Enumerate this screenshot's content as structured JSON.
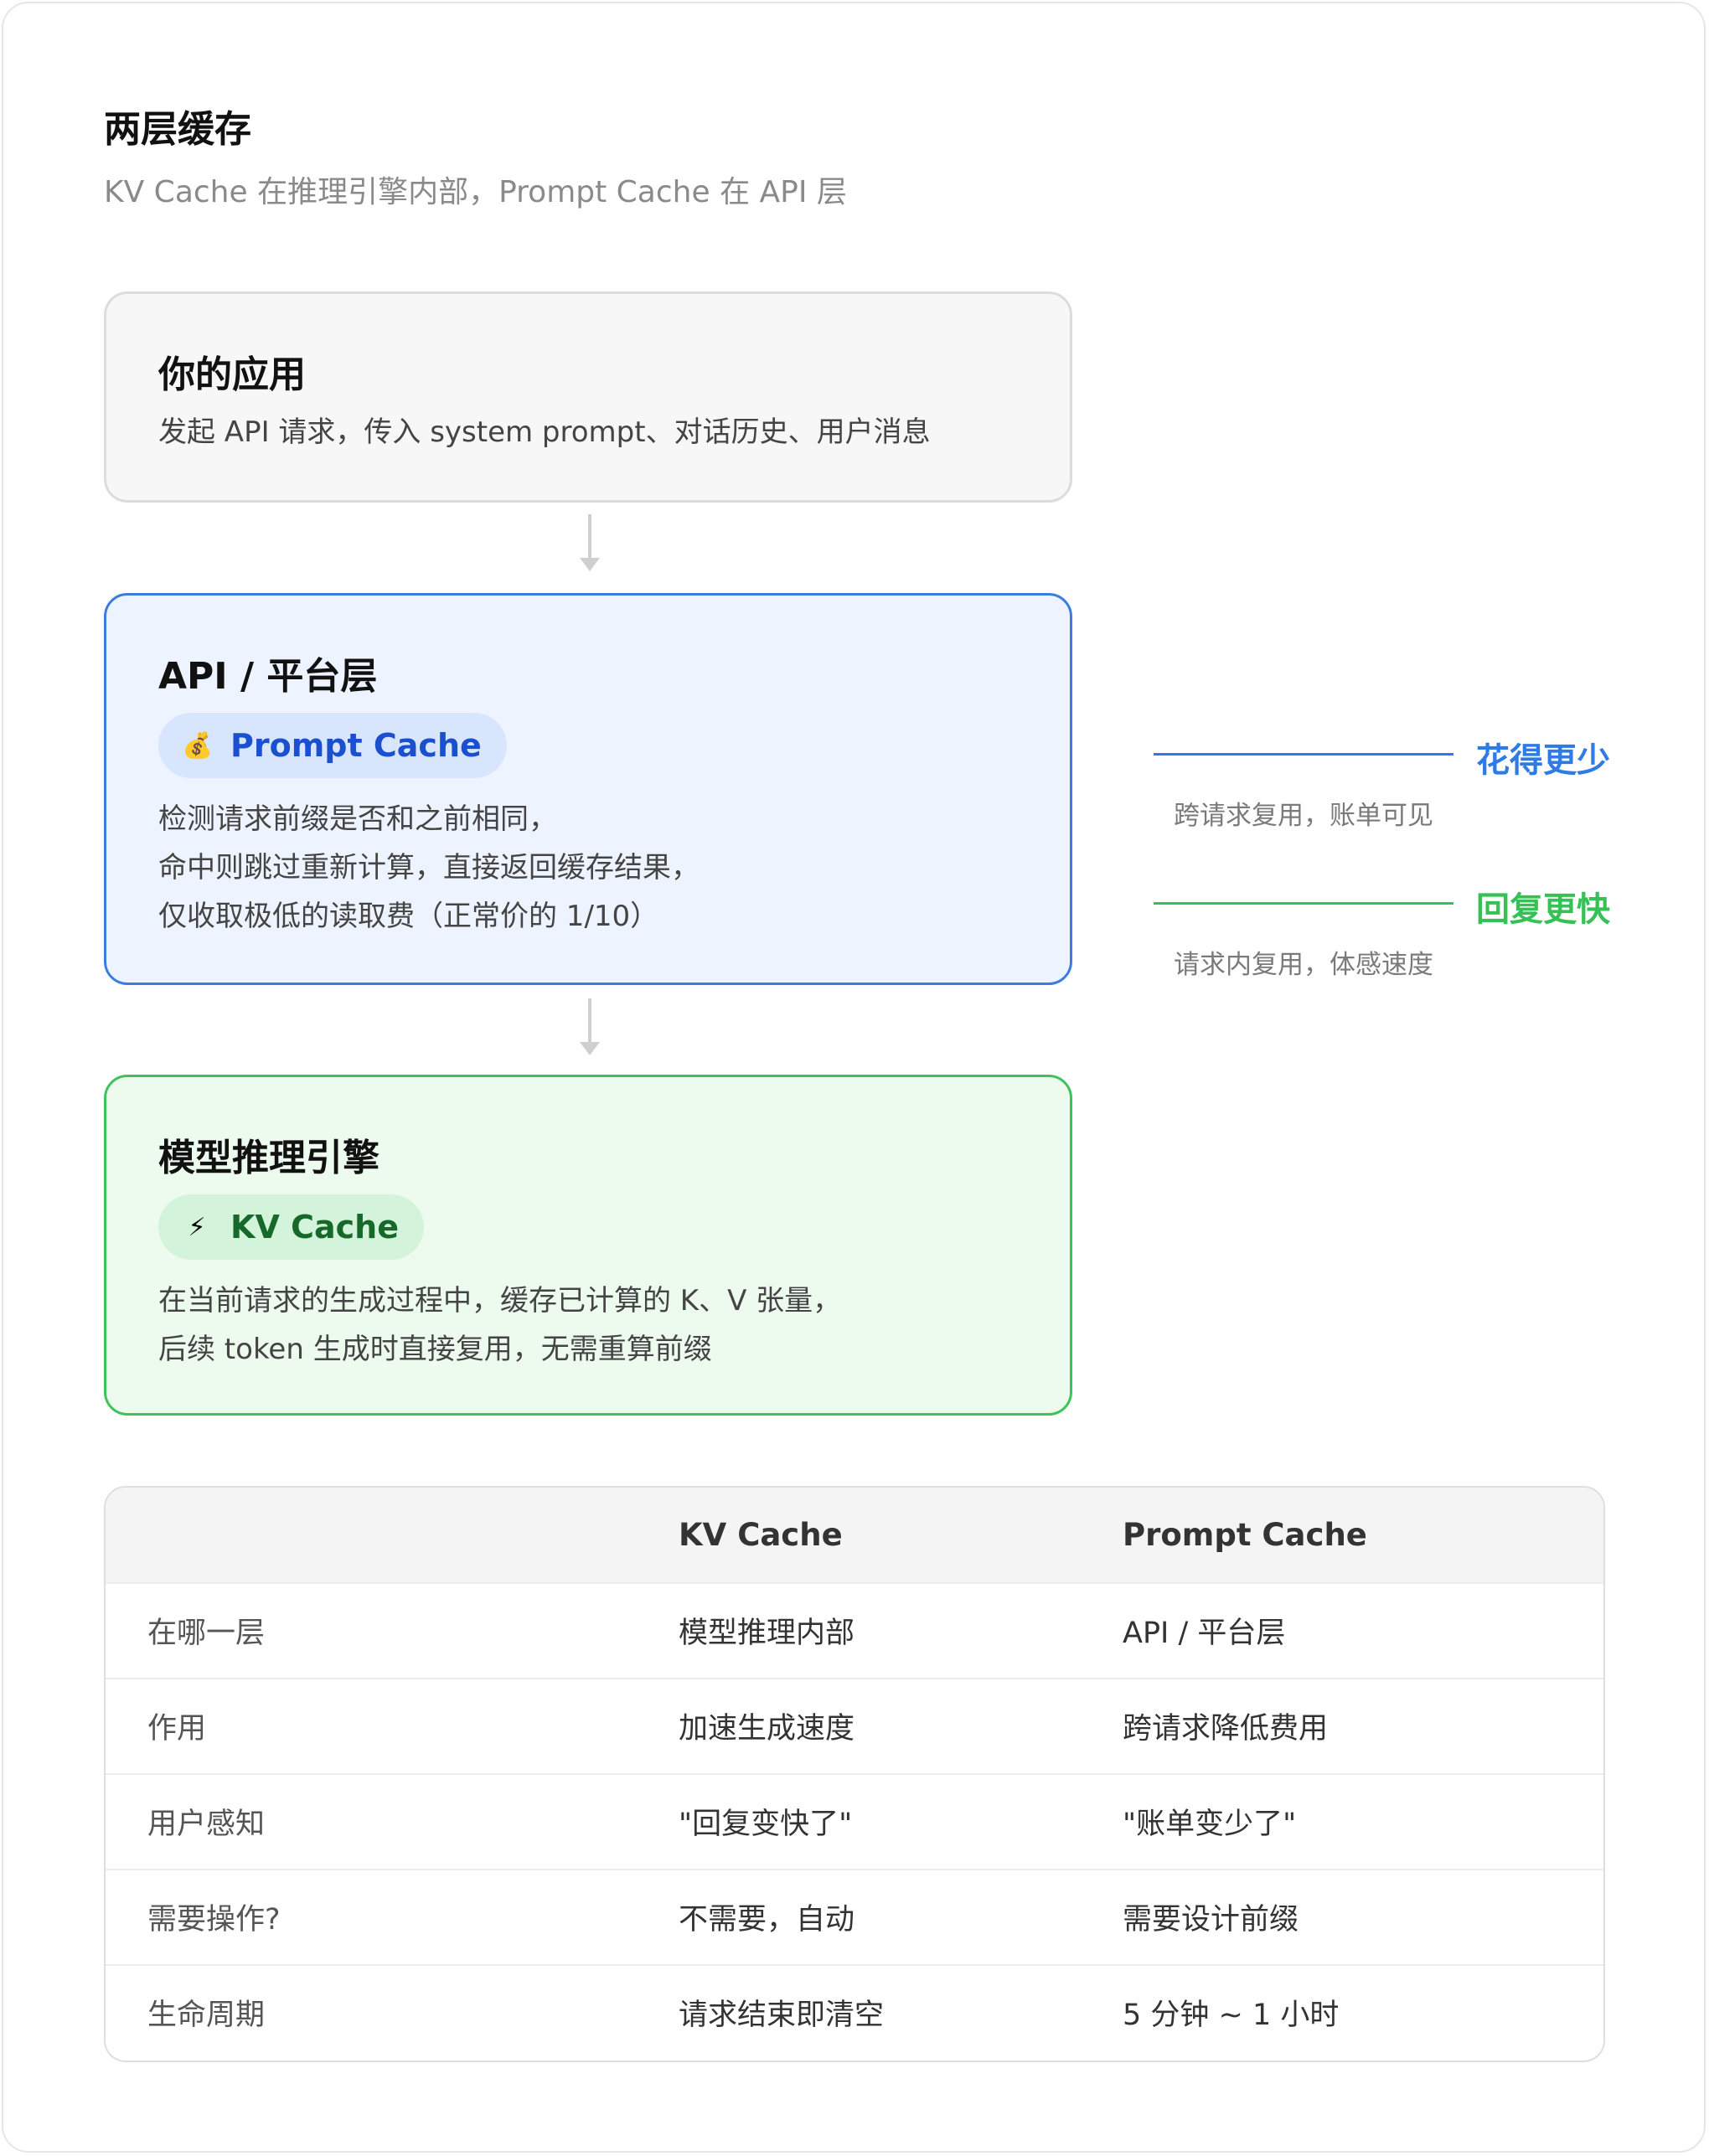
{
  "header": {
    "title": "两层缓存",
    "subtitle": "KV Cache 在推理引擎内部，Prompt Cache 在 API 层"
  },
  "app_box": {
    "title": "你的应用",
    "desc": "发起 API 请求，传入 system prompt、对话历史、用户消息"
  },
  "api_box": {
    "title": "API / 平台层",
    "pill_icon": "💰",
    "pill_label": "Prompt Cache",
    "desc_lines": [
      "检测请求前缀是否和之前相同，",
      "命中则跳过重新计算，直接返回缓存结果，",
      "仅收取极低的读取费（正常价的 1/10）"
    ]
  },
  "engine_box": {
    "title": "模型推理引擎",
    "pill_icon": "⚡",
    "pill_label": "KV Cache",
    "desc_lines": [
      "在当前请求的生成过程中，缓存已计算的 K、V 张量，",
      "后续 token 生成时直接复用，无需重算前缀"
    ]
  },
  "side": {
    "cost": {
      "label": "花得更少",
      "note": "跨请求复用，账单可见",
      "color": "#2f7be6"
    },
    "speed": {
      "label": "回复更快",
      "note": "请求内复用，体感速度",
      "color": "#35c155"
    }
  },
  "table": {
    "headers": [
      "",
      "KV Cache",
      "Prompt Cache"
    ],
    "rows": [
      [
        "在哪一层",
        "模型推理内部",
        "API / 平台层"
      ],
      [
        "作用",
        "加速生成速度",
        "跨请求降低费用"
      ],
      [
        "用户感知",
        "\"回复变快了\"",
        "\"账单变少了\""
      ],
      [
        "需要操作?",
        "不需要，自动",
        "需要设计前缀"
      ],
      [
        "生命周期",
        "请求结束即清空",
        "5 分钟 ~ 1 小时"
      ]
    ]
  },
  "colors": {
    "api_border": "#3b7ddd",
    "engine_border": "#3ec25a",
    "arrow": "#cfcfcf"
  }
}
